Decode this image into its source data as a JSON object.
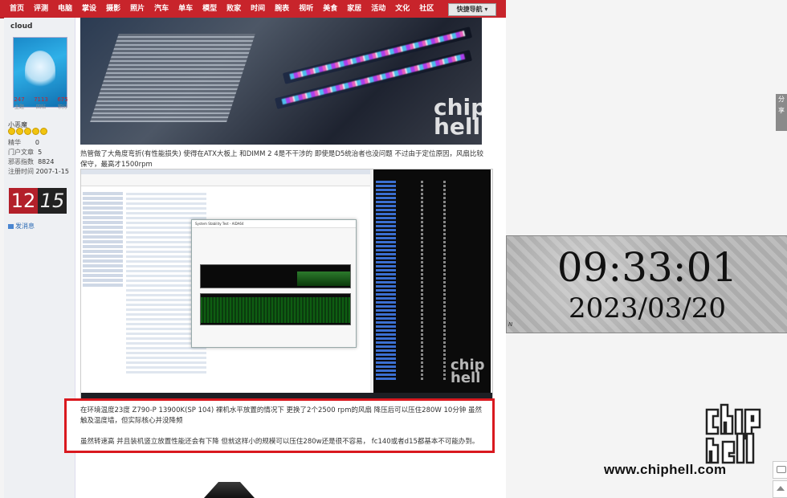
{
  "nav": {
    "items": [
      "首页",
      "评测",
      "电脑",
      "掌设",
      "摄影",
      "照片",
      "汽车",
      "单车",
      "模型",
      "败家",
      "时间",
      "腕表",
      "视听",
      "美食",
      "家居",
      "活动",
      "文化",
      "社区"
    ],
    "quick_nav": "快捷导航 ▾"
  },
  "user": {
    "name": "cloud",
    "stats": [
      {
        "value": "247",
        "label": "主题"
      },
      {
        "value": "7113",
        "label": "回帖"
      },
      {
        "value": "675",
        "label": "积分"
      }
    ],
    "rank": "小恶魔",
    "info": [
      {
        "label": "精华",
        "value": "0"
      },
      {
        "label": "门户文章",
        "value": "5"
      },
      {
        "label": "邪恶指数",
        "value": "8824"
      },
      {
        "label": "注册时间",
        "value": "2007-1-15"
      }
    ],
    "send_message": "发消息"
  },
  "widget_clock": {
    "hour": "12",
    "minute": "15"
  },
  "post": {
    "para1": "热管做了大角度弯折(有性能损失) 使得在ATX大板上 和DIMM 2 4是不干涉的 即使是D5统治者也没问题 不过由于定位原因，风扇比较保守，最高才1500rpm",
    "para2": "在环境温度23度 Z790-P 13900K(SP 104) 裸机水平放置的情况下 更换了2个2500 rpm的风扇 降压后可以压住280W 10分钟 虽然触及温度墙，但实际核心并没降频",
    "para3": "虽然转速高 并且装机竖立放置性能还会有下降 但就这样小的规模可以压住280w还是很不容易， fc140或者d15都基本不可能办到。",
    "screenshot_title": "System Stability Test - AIDA64"
  },
  "big_clock": {
    "time": "09:33:01",
    "date": "2023/03/20",
    "mark": "N"
  },
  "side_tab": "分享",
  "watermark": {
    "site": "www.chiphell.com",
    "logo": "chip hell"
  },
  "colors": {
    "nav_bg": "#c8242b",
    "highlight_box": "#d9191f"
  }
}
